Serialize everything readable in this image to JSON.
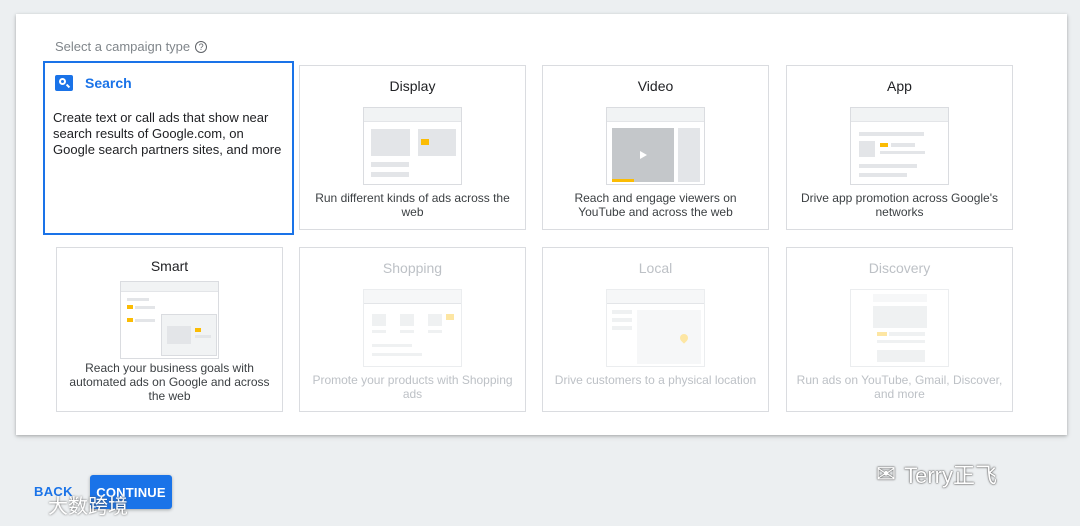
{
  "prompt": {
    "text": "Select a campaign type",
    "help": "?"
  },
  "selected_card": {
    "title": "Search",
    "description": "Create text or call ads that show near search results of Google.com, on Google search partners sites, and more"
  },
  "cards": [
    {
      "title": "Display",
      "description": "Run different kinds of ads across the web",
      "enabled": true
    },
    {
      "title": "Video",
      "description": "Reach and engage viewers on YouTube and across the web",
      "enabled": true
    },
    {
      "title": "App",
      "description": "Drive app promotion across Google's networks",
      "enabled": true
    },
    {
      "title": "Smart",
      "description": "Reach your business goals with automated ads on Google and across the web",
      "enabled": true
    },
    {
      "title": "Shopping",
      "description": "Promote your products with Shopping ads",
      "enabled": false
    },
    {
      "title": "Local",
      "description": "Drive customers to a physical location",
      "enabled": false
    },
    {
      "title": "Discovery",
      "description": "Run ads on YouTube, Gmail, Discover, and more",
      "enabled": false
    }
  ],
  "actions": {
    "back": "BACK",
    "continue": "CONTINUE"
  },
  "watermarks": {
    "right": "Terry正飞",
    "left": "大数跨境"
  },
  "colors": {
    "accent": "#1a73e8",
    "highlight": "#fbbc04",
    "disabled_text": "#bdc1c6"
  }
}
